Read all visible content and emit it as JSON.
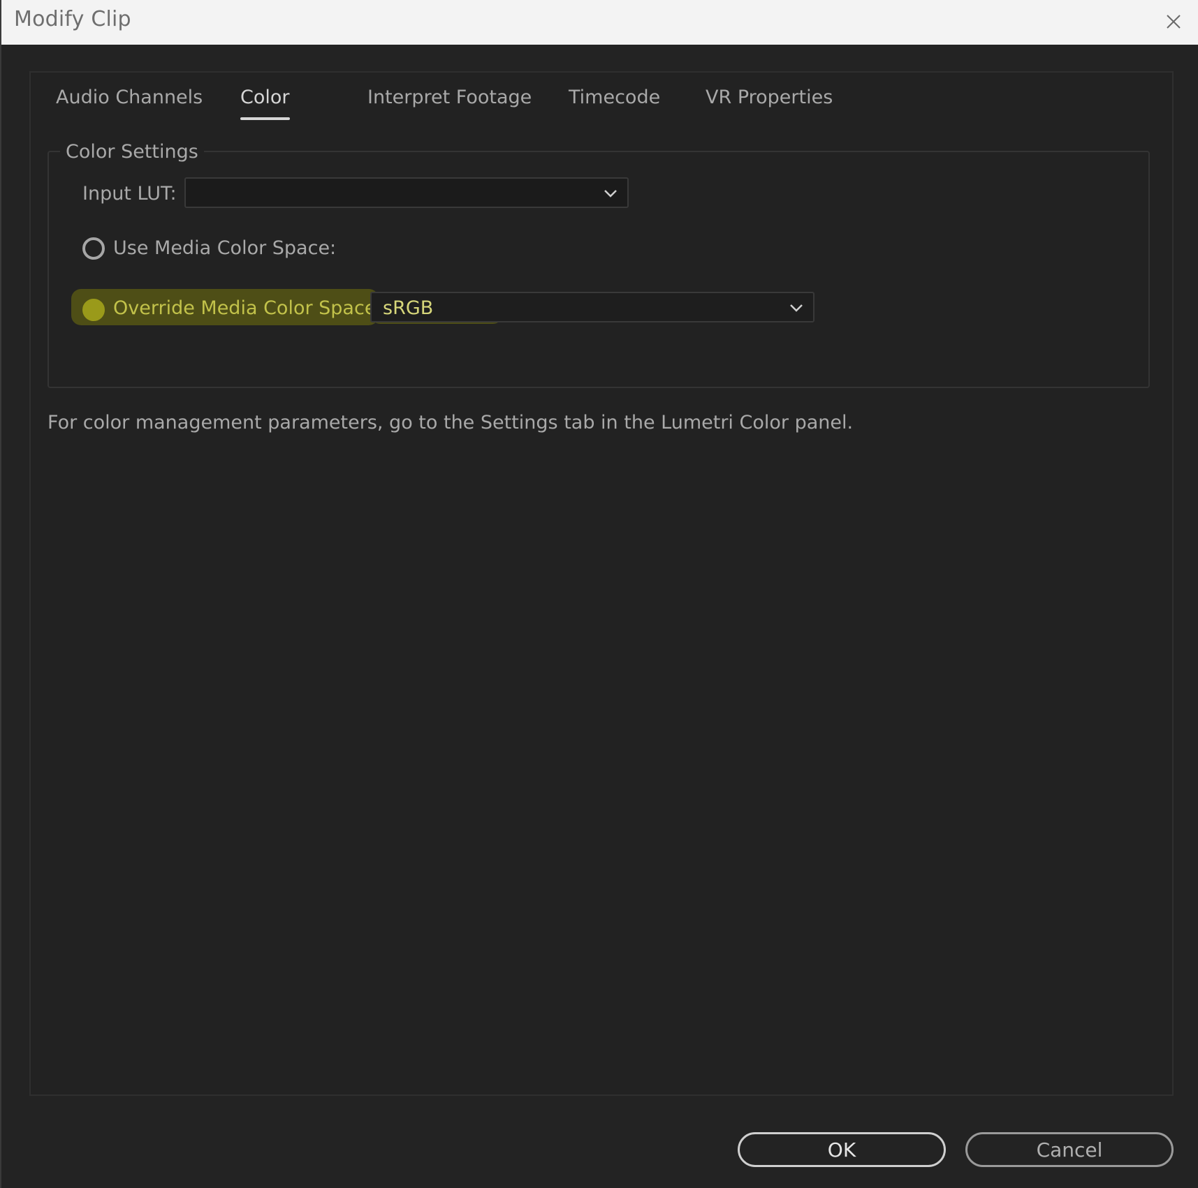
{
  "window": {
    "title": "Modify Clip"
  },
  "tabs": [
    {
      "label": "Audio Channels",
      "active": false
    },
    {
      "label": "Color",
      "active": true
    },
    {
      "label": "Interpret Footage",
      "active": false
    },
    {
      "label": "Timecode",
      "active": false
    },
    {
      "label": "VR Properties",
      "active": false
    }
  ],
  "color_settings": {
    "legend": "Color Settings",
    "input_lut": {
      "label": "Input LUT:",
      "value": ""
    },
    "use_media": {
      "label": "Use Media Color Space:",
      "selected": false
    },
    "override_media": {
      "label": "Override Media Color Space:",
      "selected": true,
      "value": "sRGB"
    }
  },
  "info_text": "For color management parameters, go to the Settings tab in the Lumetri Color panel.",
  "buttons": {
    "ok": "OK",
    "cancel": "Cancel"
  },
  "colors": {
    "background": "#232323",
    "titlebar": "#f3f3f3",
    "highlight": "#a0a000",
    "override_text": "#c2c24a",
    "radio_selected": "#9a9a1a"
  },
  "icons": {
    "close": "close-icon",
    "dropdown": "chevron-down-icon"
  }
}
